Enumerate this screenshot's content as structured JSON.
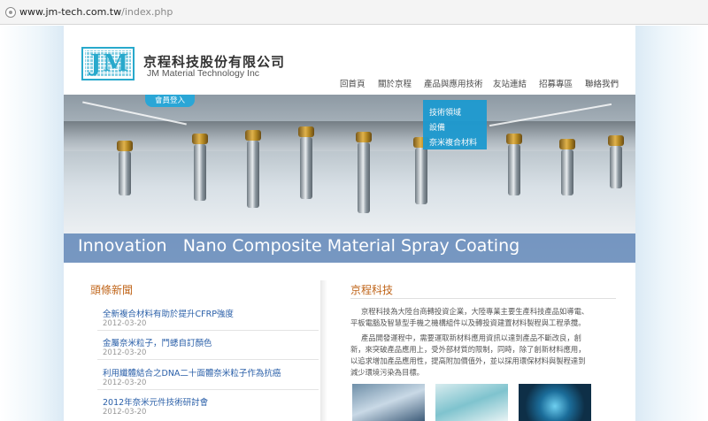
{
  "browser": {
    "url_host": "www.jm-tech.com.tw",
    "url_path": "/index.php"
  },
  "header": {
    "logo_letters": "JM",
    "company_zh": "京程科技股份有限公司",
    "company_en": "JM Material Technology Inc"
  },
  "nav": {
    "items": [
      "回首頁",
      "關於京程",
      "產品與應用技術",
      "友站連結",
      "招募專區",
      "聯絡我們"
    ]
  },
  "banner": {
    "member_login": "會員登入",
    "dropdown": [
      "技術領域",
      "設備",
      "奈米複合材料"
    ],
    "tagline": "Innovation   Nano Composite Material Spray Coating"
  },
  "news": {
    "title": "頭條新聞",
    "items": [
      {
        "title": "全新複合材料有助於提升CFRP強度",
        "date": "2012-03-20"
      },
      {
        "title": "金屬奈米粒子，鬥蟋自訂顏色",
        "date": "2012-03-20"
      },
      {
        "title": "利用纖體結合之DNA二十面體奈米粒子作為抗癌",
        "date": "2012-03-20"
      },
      {
        "title": "2012年奈米元件技術研討會",
        "date": "2012-03-20"
      }
    ]
  },
  "about": {
    "title": "京程科技",
    "lines": [
      "京程科技為大陸台商轉投資企業，大陸專業主要生產科技產品如導電、",
      "平板電腦及智慧型手機之機構組件以及轉投資建置材料製程與工程承攬。",
      "產品開發運程中，需要運取新材料應用資訊以達到產品不斷改良，創",
      "新，來突破產品應用上，受外部材質的限制，同時，除了創新材料應用，",
      "以追求增加產品應用性，提高附加價值外，並以採用環保材料與製程達到",
      "減少環境污染為目標。"
    ]
  },
  "colors": {
    "accent_blue": "#2aa6d6",
    "heading_orange": "#c0651a",
    "link_blue": "#2a5fa8"
  }
}
